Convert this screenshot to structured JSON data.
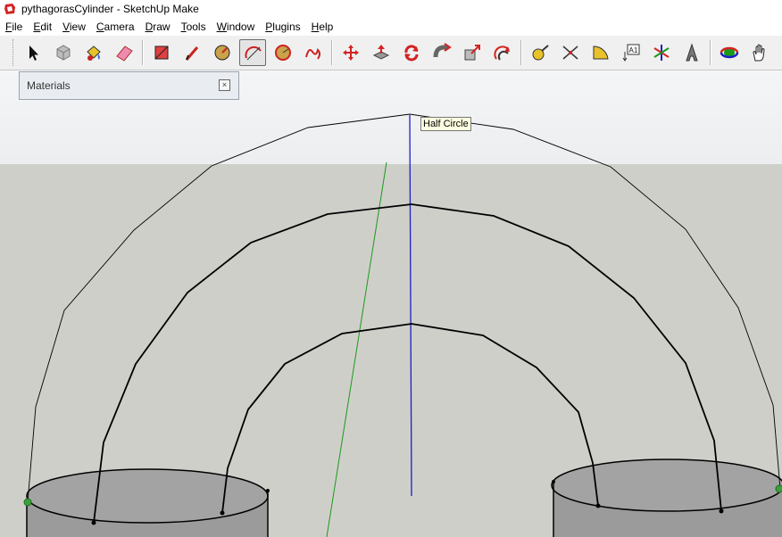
{
  "window": {
    "title": "pythagorasCylinder - SketchUp Make",
    "icon": "sketchup-logo-icon"
  },
  "menubar": {
    "items": [
      {
        "ul": "F",
        "rest": "ile"
      },
      {
        "ul": "E",
        "rest": "dit"
      },
      {
        "ul": "V",
        "rest": "iew"
      },
      {
        "ul": "C",
        "rest": "amera"
      },
      {
        "ul": "D",
        "rest": "raw"
      },
      {
        "ul": "T",
        "rest": "ools"
      },
      {
        "ul": "W",
        "rest": "indow"
      },
      {
        "ul": "P",
        "rest": "lugins"
      },
      {
        "ul": "H",
        "rest": "elp"
      }
    ]
  },
  "toolbar": {
    "tools": [
      {
        "name": "select-icon"
      },
      {
        "name": "make-component-icon"
      },
      {
        "name": "paint-bucket-icon"
      },
      {
        "name": "eraser-icon"
      },
      {
        "name": "rectangle-icon"
      },
      {
        "name": "line-icon"
      },
      {
        "name": "circle-icon"
      },
      {
        "name": "arc-icon",
        "active": true
      },
      {
        "name": "polygon-icon"
      },
      {
        "name": "freehand-icon"
      },
      {
        "name": "move-icon"
      },
      {
        "name": "push-pull-icon"
      },
      {
        "name": "rotate-icon"
      },
      {
        "name": "follow-me-icon"
      },
      {
        "name": "scale-icon"
      },
      {
        "name": "offset-icon"
      },
      {
        "name": "tape-measure-icon"
      },
      {
        "name": "dimension-icon"
      },
      {
        "name": "protractor-icon"
      },
      {
        "name": "text-icon"
      },
      {
        "name": "axes-icon"
      },
      {
        "name": "3d-text-icon"
      },
      {
        "name": "orbit-icon"
      },
      {
        "name": "pan-icon"
      }
    ]
  },
  "materials_panel": {
    "title": "Materials",
    "close_icon": "close-icon"
  },
  "tooltip": {
    "text": "Half Circle"
  },
  "colors": {
    "blue_axis": "#1e1ec8",
    "green_axis": "#1a9a1a",
    "edge": "#000000",
    "endpoint": "#3aa03a",
    "cylinder": "#9a9a9a"
  }
}
